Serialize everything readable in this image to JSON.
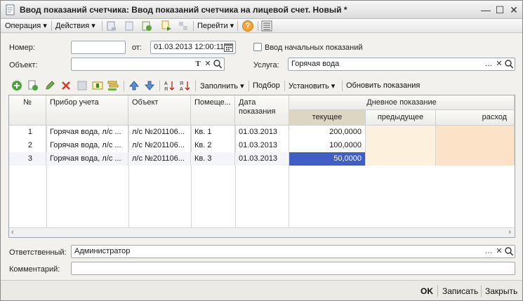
{
  "window": {
    "title": "Ввод показаний счетчика: Ввод показаний счетчика на лицевой счет. Новый *",
    "minimize_glyph": "—",
    "maximize_glyph": "☐",
    "close_glyph": "✕"
  },
  "menubar": {
    "operation": "Операция",
    "actions": "Действия",
    "goto": "Перейти",
    "help_glyph": "?"
  },
  "form": {
    "number_label": "Номер:",
    "number_value": "",
    "from_label": "от:",
    "date_value": "01.03.2013 12:00:11",
    "initial_checkbox_label": "Ввод начальных показаний",
    "object_label": "Объект:",
    "object_value": "",
    "service_label": "Услуга:",
    "service_value": "Горячая вода",
    "responsible_label": "Ответственный:",
    "responsible_value": "Администратор",
    "comment_label": "Комментарий:",
    "comment_value": ""
  },
  "table_toolbar": {
    "fill": "Заполнить",
    "selection": "Подбор",
    "set": "Установить",
    "update": "Обновить показания"
  },
  "table": {
    "headers": {
      "num": "№",
      "device": "Прибор учета",
      "object": "Объект",
      "room": "Помеще...",
      "date_line1": "Дата",
      "date_line2": "показания",
      "day_reading": "Дневное показание",
      "current": "текущее",
      "previous": "предыдущее",
      "consumption": "расход"
    },
    "rows": [
      {
        "num": "1",
        "device": "Горячая вода, л/с ...",
        "object": "л/с №201106...",
        "room": "Кв. 1",
        "date": "01.03.2013",
        "current": "200,0000",
        "previous": "",
        "consumption": ""
      },
      {
        "num": "2",
        "device": "Горячая вода, л/с ...",
        "object": "л/с №201106...",
        "room": "Кв. 2",
        "date": "01.03.2013",
        "current": "100,0000",
        "previous": "",
        "consumption": ""
      },
      {
        "num": "3",
        "device": "Горячая вода, л/с ...",
        "object": "л/с №201106...",
        "room": "Кв. 3",
        "date": "01.03.2013",
        "current": "50,0000",
        "previous": "",
        "consumption": ""
      }
    ]
  },
  "footer": {
    "ok": "OK",
    "save": "Записать",
    "close": "Закрыть"
  },
  "colors": {
    "selected_cell": "#3f5fc5",
    "readonly_cell": "#fdf0dd",
    "consumption_cell": "#fce3c8",
    "current_header": "#dcd7c2"
  }
}
